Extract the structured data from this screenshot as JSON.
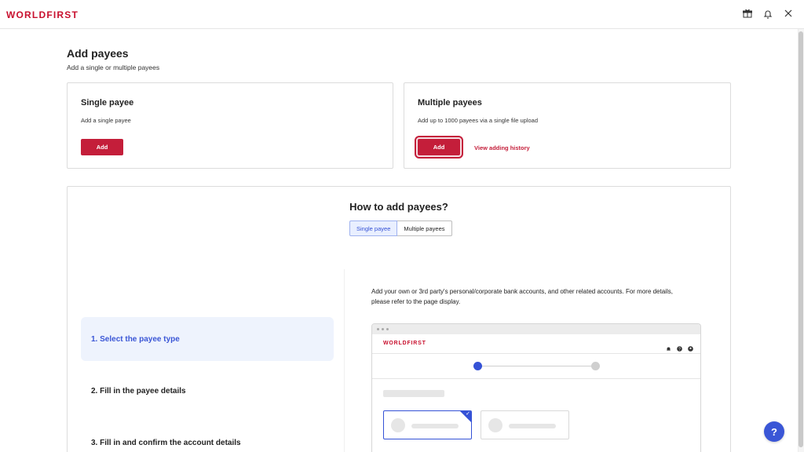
{
  "app": {
    "logo": "WORLDFIRST"
  },
  "topbar": {
    "icons": [
      "gift-icon",
      "bell-icon",
      "close-icon"
    ]
  },
  "header": {
    "title": "Add payees",
    "subtitle": "Add a single or multiple payees"
  },
  "cards": {
    "single": {
      "title": "Single payee",
      "description": "Add a single payee",
      "button": "Add"
    },
    "multiple": {
      "title": "Multiple payees",
      "description": "Add up to 1000 payees via a single file upload",
      "button": "Add",
      "link": "View adding history"
    }
  },
  "howto": {
    "title": "How to add payees?",
    "tabs": [
      {
        "label": "Single payee",
        "active": true
      },
      {
        "label": "Multiple payees",
        "active": false
      }
    ],
    "steps": [
      {
        "label": "1. Select the payee type",
        "active": true
      },
      {
        "label": "2. Fill in the payee details",
        "active": false
      },
      {
        "label": "3. Fill in and confirm the account details",
        "active": false
      }
    ],
    "description": "Add your own or 3rd party's personal/corporate bank accounts, and other related accounts. For more details, please refer to the page display.",
    "preview": {
      "logo": "WORLDFIRST",
      "progress_steps": 2,
      "current_step": 1
    }
  },
  "help": {
    "label": "?"
  },
  "colors": {
    "brand": "#c8102e",
    "accent": "#3552d6",
    "active_step_bg": "#eef3fd"
  }
}
